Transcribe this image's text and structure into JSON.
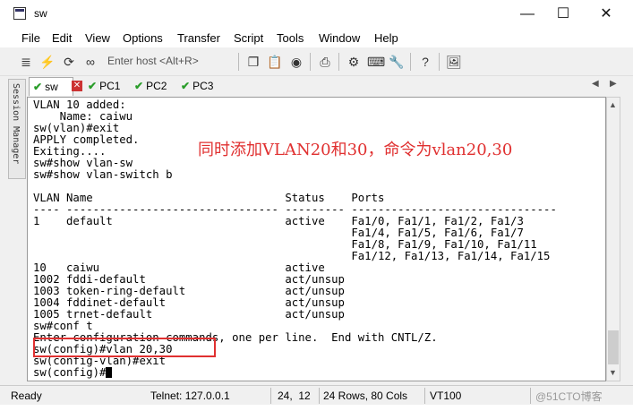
{
  "window": {
    "title": "sw"
  },
  "menu": [
    "File",
    "Edit",
    "View",
    "Options",
    "Transfer",
    "Script",
    "Tools",
    "Window",
    "Help"
  ],
  "toolbar": {
    "host_placeholder": "Enter host <Alt+R>"
  },
  "tabs": [
    {
      "label": "sw",
      "active": true
    },
    {
      "label": "PC1",
      "active": false
    },
    {
      "label": "PC2",
      "active": false
    },
    {
      "label": "PC3",
      "active": false
    }
  ],
  "sidebar": {
    "label": "Session Manager"
  },
  "terminal": {
    "lines": [
      "VLAN 10 added:",
      "    Name: caiwu",
      "sw(vlan)#exit",
      "APPLY completed.",
      "Exiting....",
      "sw#show vlan-sw",
      "sw#show vlan-switch b",
      "",
      "VLAN Name                             Status    Ports",
      "---- -------------------------------- --------- -------------------------------",
      "1    default                          active    Fa1/0, Fa1/1, Fa1/2, Fa1/3",
      "                                                Fa1/4, Fa1/5, Fa1/6, Fa1/7",
      "                                                Fa1/8, Fa1/9, Fa1/10, Fa1/11",
      "                                                Fa1/12, Fa1/13, Fa1/14, Fa1/15",
      "10   caiwu                            active",
      "1002 fddi-default                     act/unsup",
      "1003 token-ring-default               act/unsup",
      "1004 fddinet-default                  act/unsup",
      "1005 trnet-default                    act/unsup",
      "sw#conf t",
      "Enter configuration commands, one per line.  End with CNTL/Z.",
      "sw(config)#vlan 20,30",
      "sw(config-vlan)#exit",
      "sw(config)#"
    ],
    "annotation": "同时添加VLAN20和30，命令为vlan20,30"
  },
  "status": {
    "ready": "Ready",
    "connection": "Telnet: 127.0.0.1",
    "position": "24,  12",
    "size": "24 Rows, 80 Cols",
    "emulation": "VT100"
  },
  "watermark": "@51CTO博客",
  "colors": {
    "annotation": "#e03030",
    "tab_check": "#2a9d2a"
  }
}
